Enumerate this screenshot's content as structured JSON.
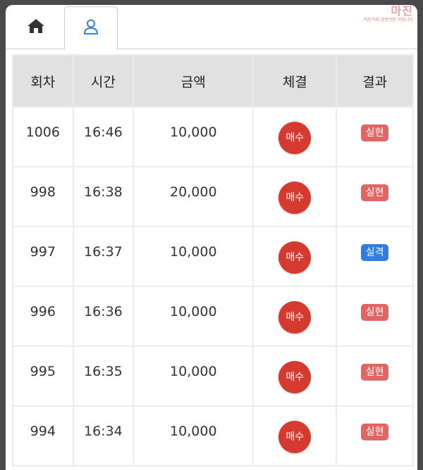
{
  "watermark": {
    "title": "마진",
    "subtitle": "마진거래 검증전문 커뮤니티"
  },
  "tabs": [
    {
      "icon": "home-icon",
      "active": false
    },
    {
      "icon": "user-icon",
      "active": true
    }
  ],
  "table": {
    "headers": [
      "회차",
      "시간",
      "금액",
      "체결",
      "결과"
    ],
    "rows": [
      {
        "round": "1006",
        "time": "16:46",
        "amount": "10,000",
        "trade": "매수",
        "result": "실현",
        "result_color": "#e06666"
      },
      {
        "round": "998",
        "time": "16:38",
        "amount": "20,000",
        "trade": "매수",
        "result": "실현",
        "result_color": "#e06666"
      },
      {
        "round": "997",
        "time": "16:37",
        "amount": "10,000",
        "trade": "매수",
        "result": "실격",
        "result_color": "#2f7de0"
      },
      {
        "round": "996",
        "time": "16:36",
        "amount": "10,000",
        "trade": "매수",
        "result": "실현",
        "result_color": "#e06666"
      },
      {
        "round": "995",
        "time": "16:35",
        "amount": "10,000",
        "trade": "매수",
        "result": "실현",
        "result_color": "#e06666"
      },
      {
        "round": "994",
        "time": "16:34",
        "amount": "10,000",
        "trade": "매수",
        "result": "실현",
        "result_color": "#e06666"
      }
    ]
  }
}
